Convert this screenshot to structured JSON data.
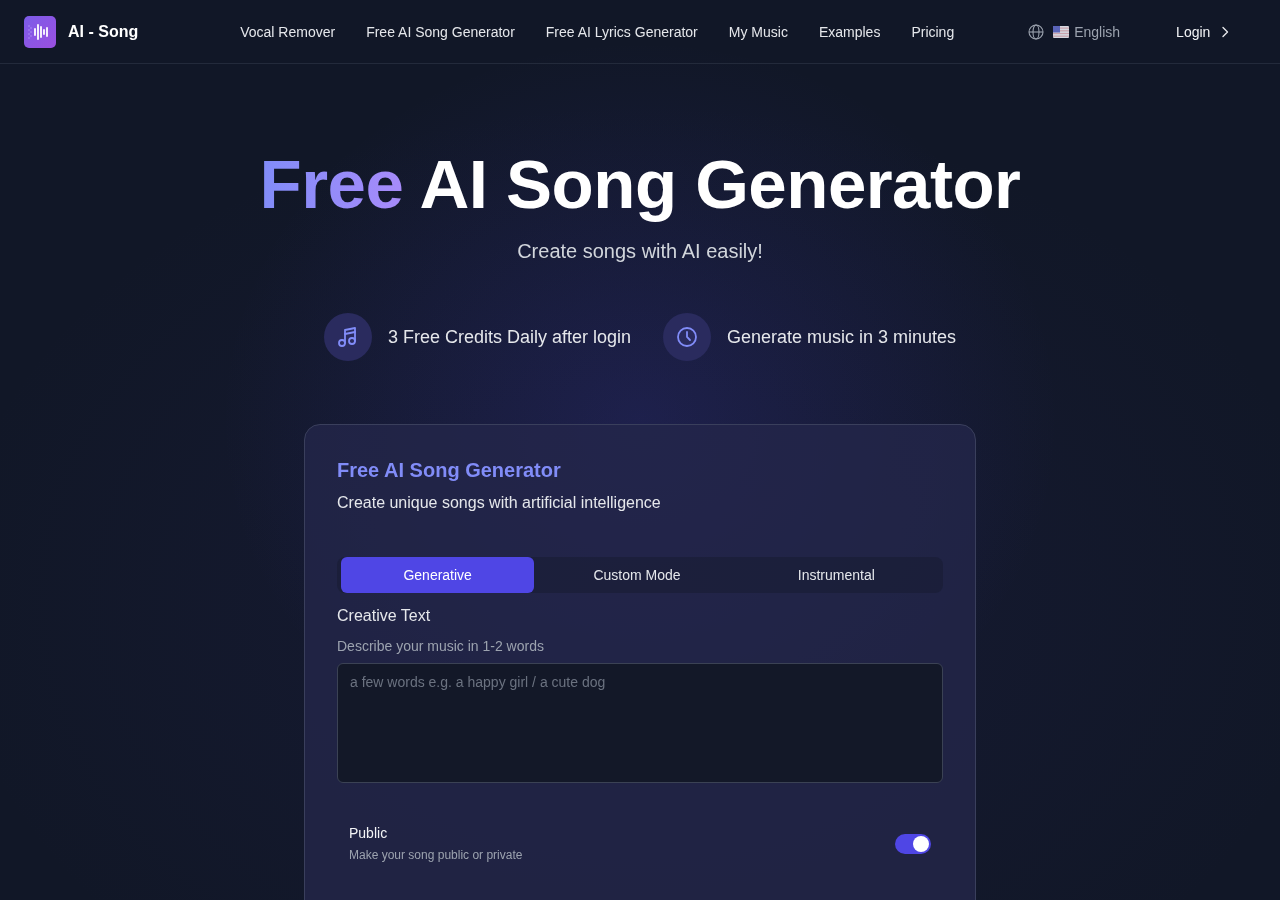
{
  "header": {
    "logo_text": "AI - Song",
    "nav": [
      "Vocal Remover",
      "Free AI Song Generator",
      "Free AI Lyrics Generator",
      "My Music",
      "Examples",
      "Pricing"
    ],
    "language": "English",
    "login": "Login"
  },
  "hero": {
    "title_highlight": "Free",
    "title_rest": "AI Song Generator",
    "subtitle": "Create songs with AI easily!"
  },
  "features": [
    {
      "kind": "music",
      "text": "3 Free Credits Daily after login"
    },
    {
      "kind": "clock",
      "text": "Generate music in 3 minutes"
    }
  ],
  "card": {
    "title": "Free AI Song Generator",
    "subtitle": "Create unique songs with artificial intelligence",
    "tabs": [
      {
        "label": "Generative",
        "selected": true
      },
      {
        "label": "Custom Mode",
        "selected": false
      },
      {
        "label": "Instrumental",
        "selected": false
      }
    ],
    "field": {
      "label": "Creative Text",
      "hint": "Describe your music in 1-2 words",
      "placeholder": "a few words e.g. a happy girl / a cute dog"
    },
    "public": {
      "label": "Public",
      "description": "Make your song public or private",
      "on": true
    }
  }
}
